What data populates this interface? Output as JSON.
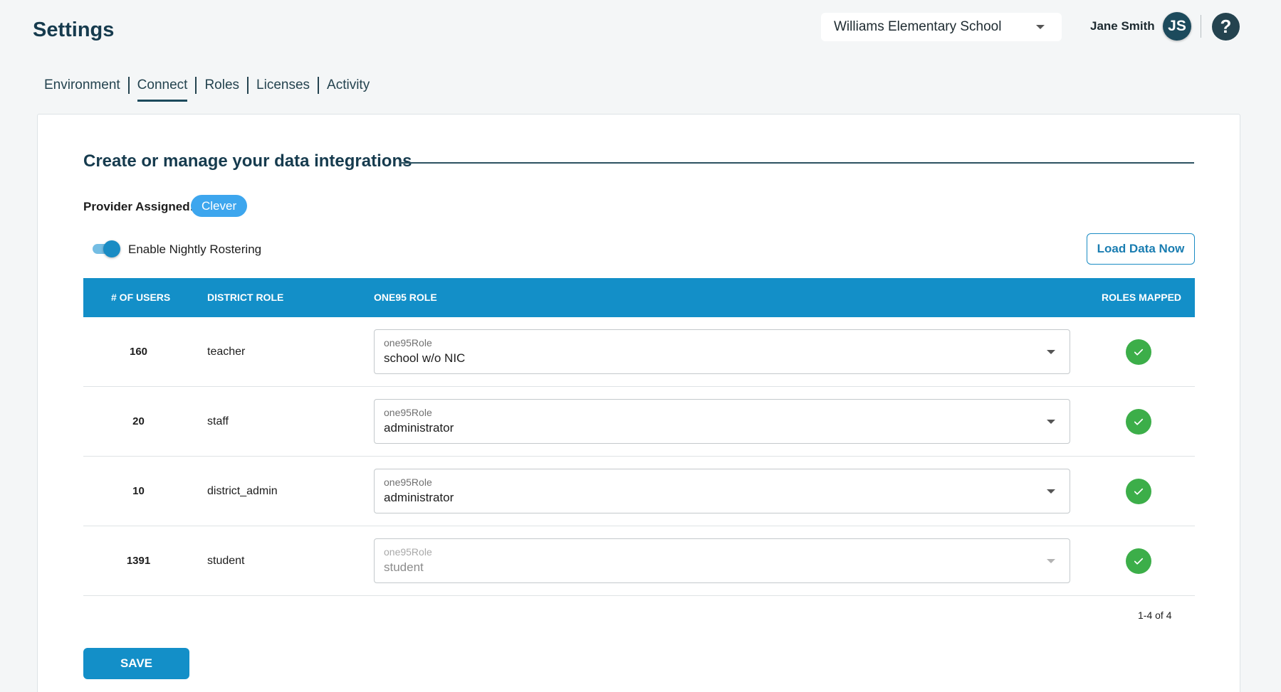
{
  "header": {
    "title": "Settings",
    "school_select": "Williams Elementary School",
    "user_name": "Jane Smith",
    "avatar_initials": "JS",
    "help_symbol": "?"
  },
  "tabs": [
    {
      "label": "Environment",
      "active": false
    },
    {
      "label": "Connect",
      "active": true
    },
    {
      "label": "Roles",
      "active": false
    },
    {
      "label": "Licenses",
      "active": false
    },
    {
      "label": "Activity",
      "active": false
    }
  ],
  "section": {
    "title": "Create or manage your data integrations",
    "provider_label": "Provider Assigned:",
    "provider_value": "Clever",
    "toggle_label": "Enable Nightly Rostering",
    "toggle_on": true,
    "load_button": "Load Data Now"
  },
  "table": {
    "headers": {
      "users": "# of Users",
      "district_role": "District Role",
      "one95_role": "One95 Role",
      "roles_mapped": "Roles Mapped"
    },
    "rows": [
      {
        "users": "160",
        "district_role": "teacher",
        "select_label": "one95Role",
        "select_value": "school w/o NIC",
        "disabled": false,
        "mapped": true
      },
      {
        "users": "20",
        "district_role": "staff",
        "select_label": "one95Role",
        "select_value": "administrator",
        "disabled": false,
        "mapped": true
      },
      {
        "users": "10",
        "district_role": "district_admin",
        "select_label": "one95Role",
        "select_value": "administrator",
        "disabled": false,
        "mapped": true
      },
      {
        "users": "1391",
        "district_role": "student",
        "select_label": "one95Role",
        "select_value": "student",
        "disabled": true,
        "mapped": true
      }
    ],
    "pagination": "1-4 of 4"
  },
  "save_button": "Save",
  "colors": {
    "primary": "#138fc8",
    "dark_text": "#163b4e",
    "success": "#3cae49",
    "chip": "#3da6ee"
  }
}
